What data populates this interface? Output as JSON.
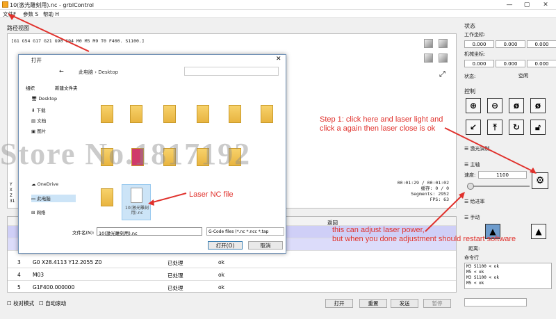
{
  "window": {
    "title": "10(激光雕刻用).nc - grblControl",
    "minimize": "—",
    "maximize": "▢",
    "close": "✕"
  },
  "menu": [
    "文件F",
    "参数 S",
    "帮助 H"
  ],
  "visualizer": {
    "label": "路径视图",
    "gcode_line": "[G1 G54 G17 G21 G90 G94 M0 M5 M9 T0 F400. S1100.]",
    "left_marks": [
      "Y",
      "X",
      "Z",
      "31"
    ],
    "stats": {
      "time": "00:01:29 / 00:01:02",
      "buffer": "缓存:  0 / 0",
      "segments": "Segments: 2952",
      "fps": "FPS: 63"
    }
  },
  "table": {
    "header": "返回",
    "rows": [
      {
        "n": "3",
        "cmd": "G0 X28.4113 Y12.2055 Z0",
        "state": "已处理",
        "resp": "ok"
      },
      {
        "n": "4",
        "cmd": "M03",
        "state": "已处理",
        "resp": "ok"
      },
      {
        "n": "5",
        "cmd": "G1F400.000000",
        "state": "已处理",
        "resp": "ok"
      }
    ]
  },
  "bottom": {
    "check_mode": "校对模式",
    "auto_scroll": "自动滚动",
    "open": "打开",
    "reset": "重置",
    "send": "发送",
    "pause": "暂停"
  },
  "right": {
    "status_title": "状态",
    "work_coord": "工作坐标:",
    "machine_coord": "机械坐标:",
    "work_vals": [
      "0.000",
      "0.000",
      "0.000"
    ],
    "machine_vals": [
      "0.000",
      "0.000",
      "0.000"
    ],
    "state_label": "状态:",
    "state_value": "空闲",
    "control_title": "控制",
    "spindle_group": "激光调制",
    "spindle_title": "主轴",
    "speed_label": "速度:",
    "speed_value": "1100",
    "feed_title": "给进率",
    "jog_title": "手动",
    "step_label": "距离:",
    "console_title": "命令行",
    "console_lines": [
      "M3 S1100 < ok",
      "M5 < ok",
      "M3 S1100 < ok",
      "M5 < ok"
    ]
  },
  "dialog": {
    "title": "打开",
    "path": [
      "此电脑",
      "Desktop"
    ],
    "organize": "组织",
    "new_folder": "新建文件夹",
    "nav": [
      "Desktop",
      "下载",
      "文档",
      "图片",
      "",
      "",
      "",
      "",
      "",
      "OneDrive",
      "此电脑",
      "网络"
    ],
    "file_name_label": "文件名(N):",
    "file_name_value": "10(激光雕刻用).nc",
    "filter": "G-Code files (*.nc *.ncc *.tap",
    "open": "打开(O)",
    "cancel": "取消",
    "file_icon_label": "10(激光雕刻用).nc"
  },
  "watermark": "Store No.1817192",
  "annotations": {
    "step1": "Step 1: click here and laser light and\nclick a again then laser close is ok",
    "laser_nc": "Laser NC file",
    "power": "this can adjust laser power,\nbut when you done adjustment should restart software"
  },
  "colors": {
    "accent": "#e0312c",
    "dialog_border": "#6d8fb5",
    "selection": "#cce4f7"
  }
}
